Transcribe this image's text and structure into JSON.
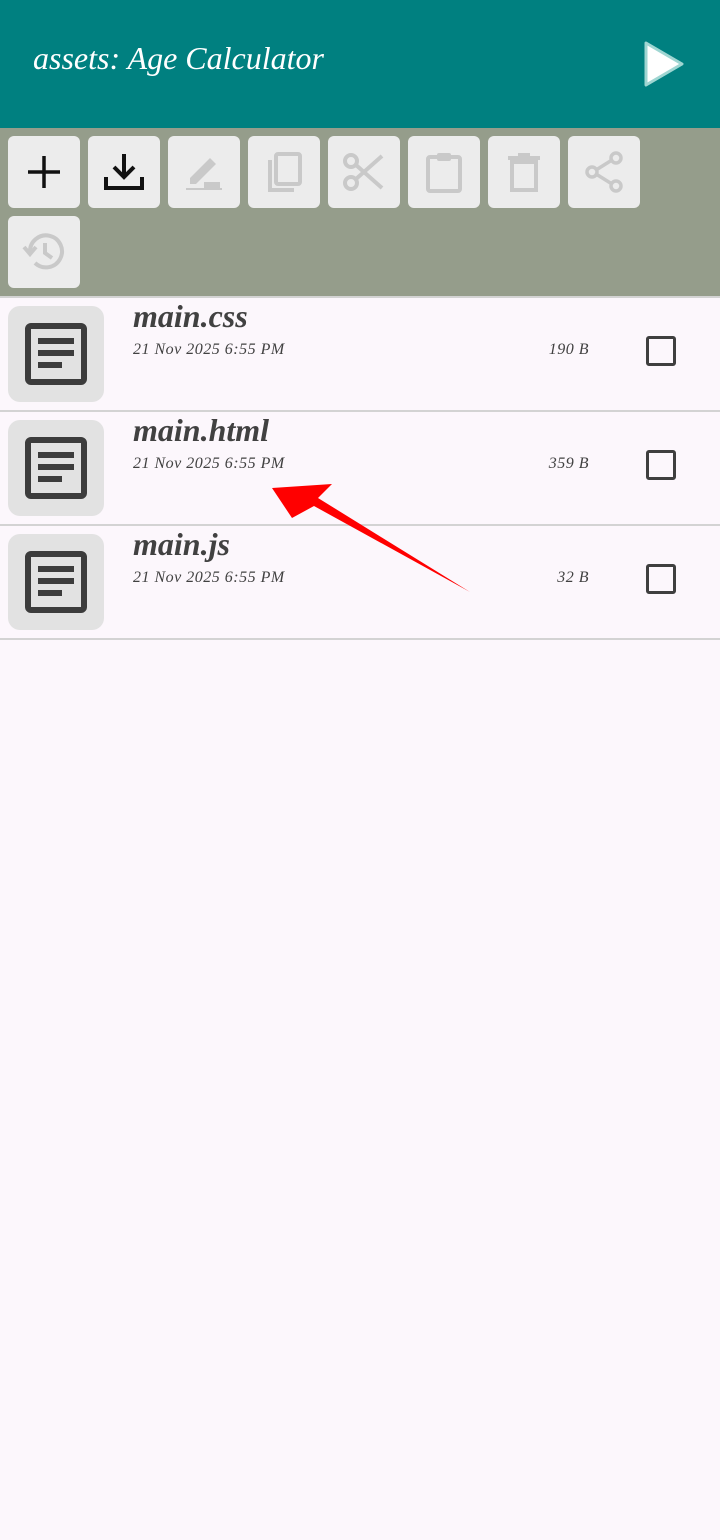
{
  "appbar": {
    "title": "assets: Age Calculator",
    "run_icon": "play-icon",
    "background": "#008080"
  },
  "toolbar": {
    "background": "#959d8b",
    "buttons": [
      {
        "name": "new-button",
        "icon": "plus-icon",
        "enabled": true
      },
      {
        "name": "import-button",
        "icon": "download-icon",
        "enabled": true
      },
      {
        "name": "rename-button",
        "icon": "edit-icon",
        "enabled": false
      },
      {
        "name": "copy-button",
        "icon": "copy-icon",
        "enabled": false
      },
      {
        "name": "cut-button",
        "icon": "scissors-icon",
        "enabled": false
      },
      {
        "name": "paste-button",
        "icon": "clipboard-icon",
        "enabled": false
      },
      {
        "name": "delete-button",
        "icon": "trash-icon",
        "enabled": false
      },
      {
        "name": "share-button",
        "icon": "share-icon",
        "enabled": false
      },
      {
        "name": "history-button",
        "icon": "history-icon",
        "enabled": false
      }
    ]
  },
  "files": [
    {
      "name": "main.css",
      "date": "21 Nov 2025 6:55 PM",
      "size": "190 B",
      "icon": "document-icon",
      "checked": false
    },
    {
      "name": "main.html",
      "date": "21 Nov 2025 6:55 PM",
      "size": "359 B",
      "icon": "document-icon",
      "checked": false
    },
    {
      "name": "main.js",
      "date": "21 Nov 2025 6:55 PM",
      "size": "32 B",
      "icon": "document-icon",
      "checked": false
    }
  ],
  "annotation": {
    "icon": "red-arrow-icon",
    "color": "#ff0000"
  }
}
